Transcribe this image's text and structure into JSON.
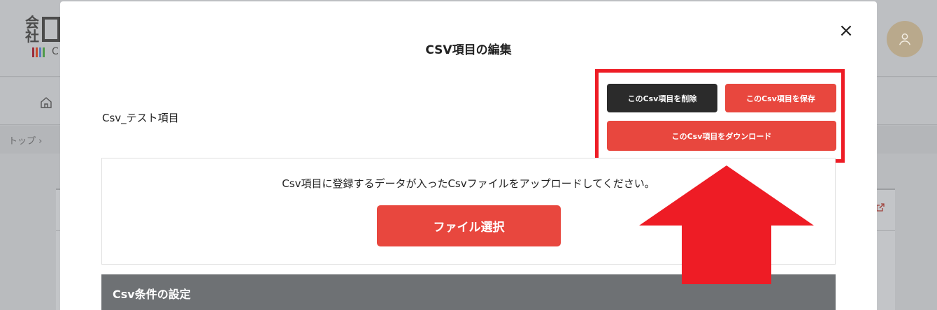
{
  "background": {
    "logo_kanji": "会社",
    "logo_letter": "C",
    "breadcrumb": "トップ ›",
    "bar_colors": [
      "#9b2b3a",
      "#c94b2b",
      "#5a7bc1",
      "#4f9a4a"
    ]
  },
  "modal": {
    "title": "CSV項目の編集",
    "close_label": "×",
    "item_name": "Csv_テスト項目",
    "delete_label": "このCsv項目を削除",
    "save_label": "このCsv項目を保存",
    "download_label": "このCsv項目をダウンロード",
    "upload_instruction": "Csv項目に登録するデータが入ったCsvファイルをアップロードしてください。",
    "file_select_label": "ファイル選択",
    "section_title": "Csv条件の設定"
  },
  "colors": {
    "accent": "#e8473e",
    "dark": "#2b2b2b",
    "annotation": "#ee1c25"
  }
}
